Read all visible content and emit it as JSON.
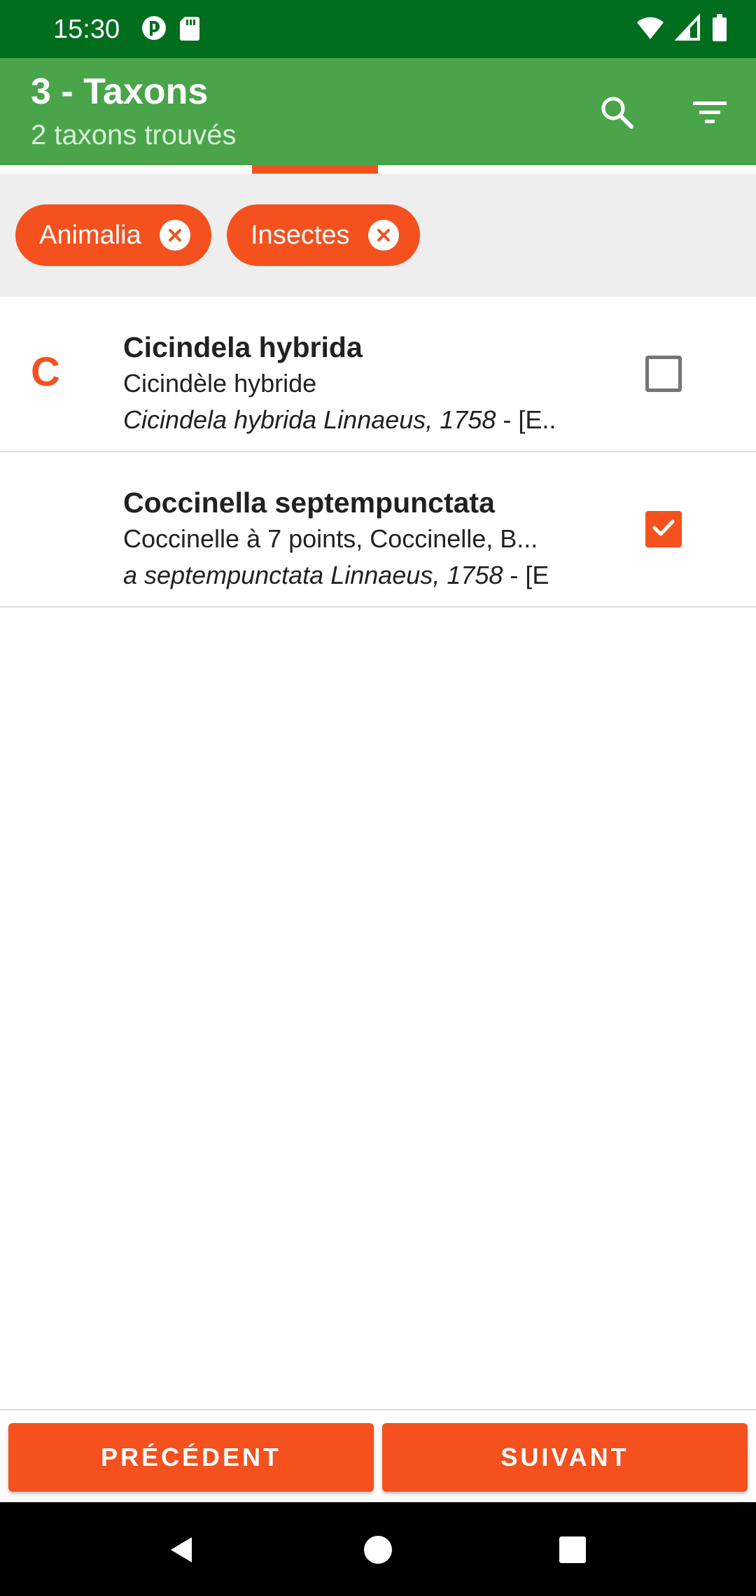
{
  "status_bar": {
    "time": "15:30",
    "icons": [
      "app-notification-icon",
      "sd-card-icon",
      "wifi-icon",
      "signal-icon",
      "battery-icon"
    ]
  },
  "app_bar": {
    "title": "3 - Taxons",
    "subtitle": "2 taxons trouvés",
    "actions": [
      "search-icon",
      "filter-icon"
    ]
  },
  "filters": {
    "chips": [
      {
        "label": "Animalia"
      },
      {
        "label": "Insectes"
      }
    ]
  },
  "taxa": [
    {
      "section_letter": "C",
      "name": "Cicindela hybrida",
      "vernacular": "Cicindèle hybride",
      "authority": "Cicindela hybrida Linnaeus, 1758",
      "authority_suffix": " - [E..",
      "checked": false
    },
    {
      "section_letter": "",
      "name": "Coccinella septempunctata",
      "vernacular": "Coccinelle à 7 points, Coccinelle, B...",
      "authority": "a septempunctata Linnaeus, 1758",
      "authority_suffix": " - [E",
      "checked": true
    }
  ],
  "buttons": {
    "previous": "PRÉCÉDENT",
    "next": "SUIVANT"
  },
  "colors": {
    "status_bar": "#006d1f",
    "app_bar": "#4aa44a",
    "accent": "#f4511e"
  }
}
